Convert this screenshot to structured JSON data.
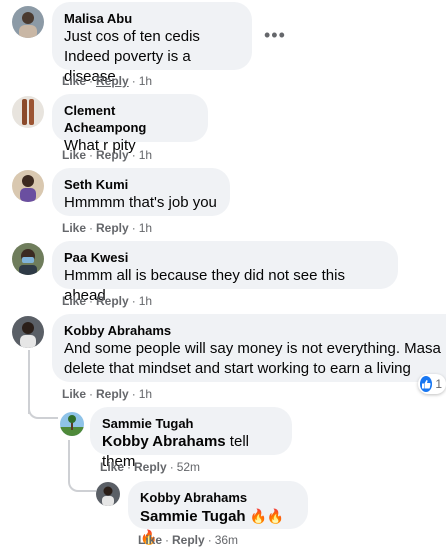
{
  "comments": [
    {
      "author": "Malisa Abu",
      "lines": [
        "Just cos of ten cedis",
        "Indeed poverty is a disease"
      ],
      "like": "Like",
      "reply": "Reply",
      "time": "1h"
    },
    {
      "author": "Clement Acheampong",
      "lines": [
        "What r pity"
      ],
      "like": "Like",
      "reply": "Reply",
      "time": "1h"
    },
    {
      "author": "Seth Kumi",
      "lines": [
        "Hmmmm that's job you"
      ],
      "like": "Like",
      "reply": "Reply",
      "time": "1h"
    },
    {
      "author": "Paa Kwesi",
      "lines": [
        "Hmmm all is because they did not see this ahead"
      ],
      "like": "Like",
      "reply": "Reply",
      "time": "1h"
    },
    {
      "author": "Kobby Abrahams",
      "lines": [
        "And some people will say money is not everything. Masa",
        "delete that mindset and start working to earn a living"
      ],
      "like": "Like",
      "reply": "Reply",
      "time": "1h",
      "reactions": "1"
    }
  ],
  "replies": [
    {
      "author": "Sammie Tugah",
      "mention": "Kobby Abrahams",
      "text": " tell them",
      "like": "Like",
      "reply": "Reply",
      "time": "52m"
    },
    {
      "author": "Kobby Abrahams",
      "mention": "Sammie Tugah",
      "text": " 🔥🔥🔥",
      "like": "Like",
      "reply": "Reply",
      "time": "36m"
    }
  ],
  "icons": {
    "more": "more-options-icon",
    "like": "like-reaction-icon"
  },
  "colors": {
    "bubble": "#f0f2f5",
    "meta": "#65676b",
    "like_blue": "#1877f2"
  }
}
